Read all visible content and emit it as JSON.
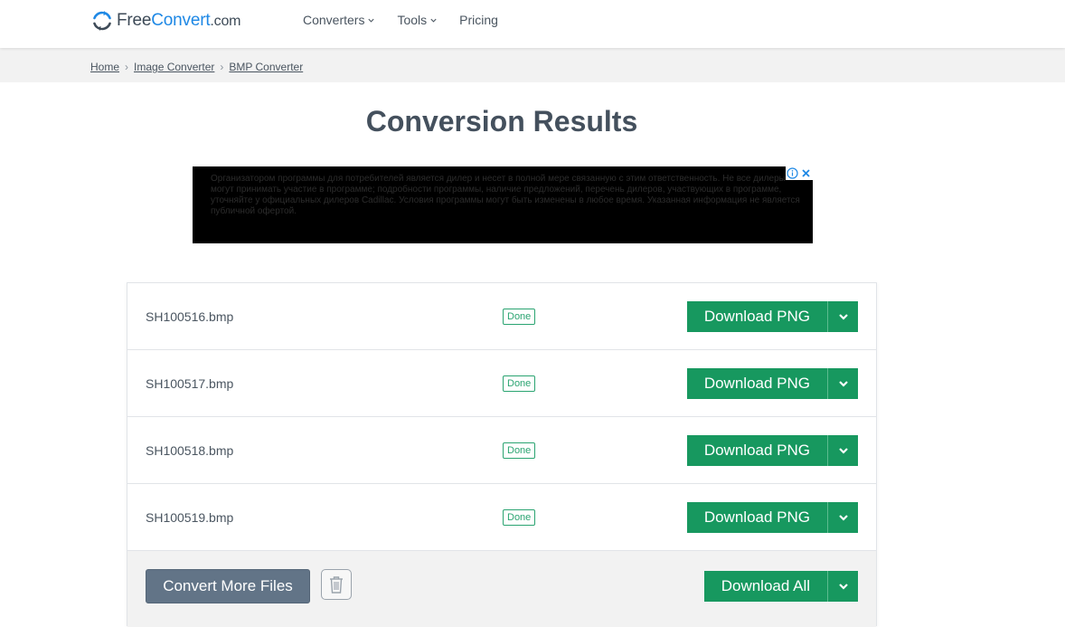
{
  "header": {
    "logo_main": "Free",
    "logo_accent": "Convert",
    "logo_domain": ".com",
    "nav": [
      {
        "label": "Converters",
        "has_menu": true
      },
      {
        "label": "Tools",
        "has_menu": true
      },
      {
        "label": "Pricing",
        "has_menu": false
      }
    ]
  },
  "breadcrumb": [
    "Home",
    "Image Converter",
    "BMP Converter"
  ],
  "page_title": "Conversion Results",
  "ad": {
    "text": "Организатором программы для потребителей является дилер и несет в полной мере связанную с этим ответственность. Не все дилеры могут принимать участие в программе; подробности программы, наличие предложений, перечень дилеров, участвующих в программе, уточняйте у официальных дилеров Cadillac. Условия программы могут быть изменены в любое время. Указанная информация не является публичной офертой."
  },
  "files": [
    {
      "name": "SH100516.bmp",
      "status": "Done",
      "action": "Download PNG"
    },
    {
      "name": "SH100517.bmp",
      "status": "Done",
      "action": "Download PNG"
    },
    {
      "name": "SH100518.bmp",
      "status": "Done",
      "action": "Download PNG"
    },
    {
      "name": "SH100519.bmp",
      "status": "Done",
      "action": "Download PNG"
    }
  ],
  "footer": {
    "convert_more": "Convert More Files",
    "download_all": "Download All"
  },
  "colors": {
    "accent_green": "#17985f",
    "status_green": "#2aa471",
    "logo_blue": "#1e88e5",
    "slate_button": "#627487"
  }
}
